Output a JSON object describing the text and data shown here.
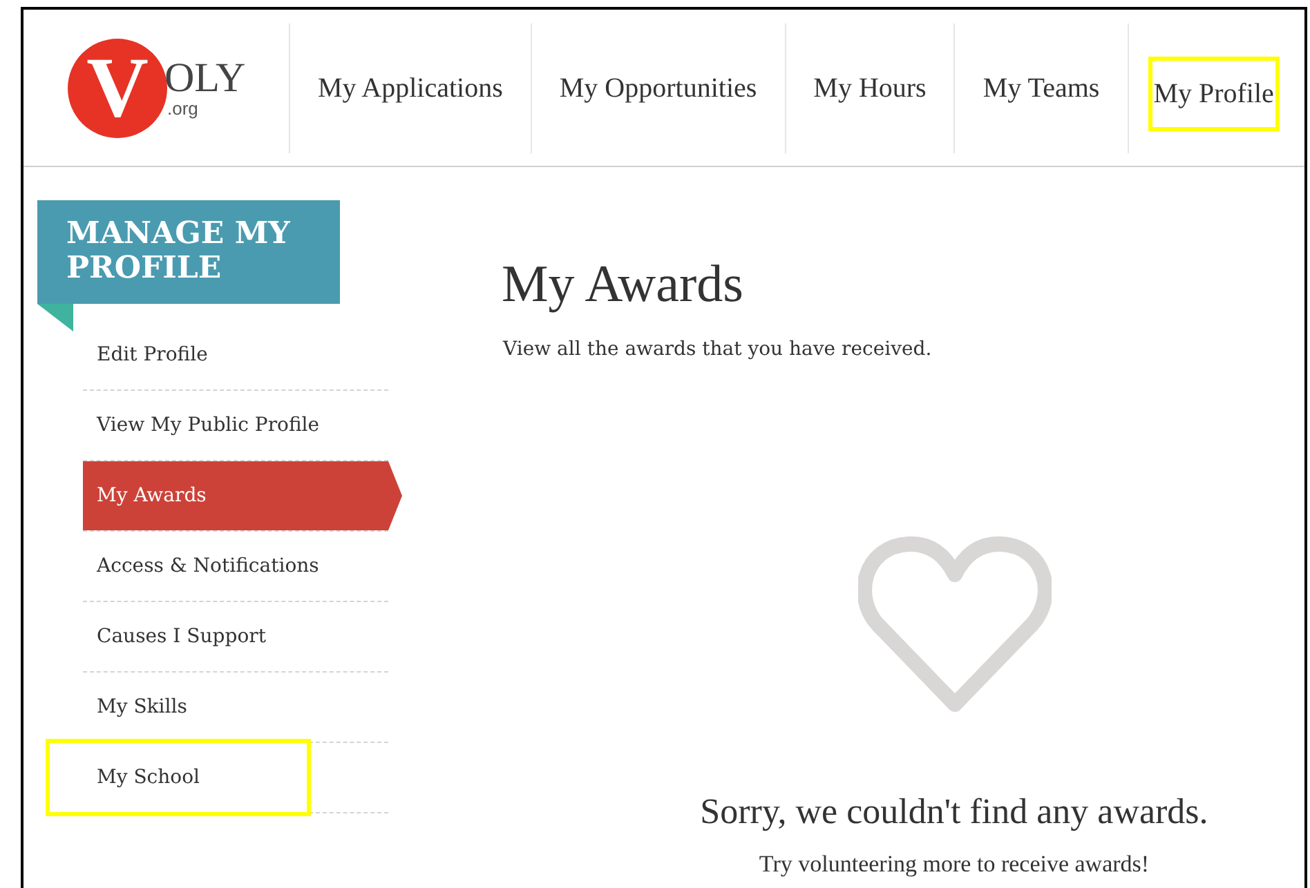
{
  "logo": {
    "letter": "V",
    "wordmark": "OLY",
    "domain": ".org"
  },
  "nav": [
    {
      "label": "My Applications",
      "highlighted": false
    },
    {
      "label": "My Opportunities",
      "highlighted": false
    },
    {
      "label": "My Hours",
      "highlighted": false
    },
    {
      "label": "My Teams",
      "highlighted": false
    },
    {
      "label": "My Profile",
      "highlighted": true
    }
  ],
  "sidebar": {
    "title": "MANAGE MY PROFILE",
    "items": [
      {
        "label": "Edit Profile",
        "selected": false,
        "highlighted": false
      },
      {
        "label": "View My Public Profile",
        "selected": false,
        "highlighted": false
      },
      {
        "label": "My Awards",
        "selected": true,
        "highlighted": false
      },
      {
        "label": "Access & Notifications",
        "selected": false,
        "highlighted": false
      },
      {
        "label": "Causes I Support",
        "selected": false,
        "highlighted": false
      },
      {
        "label": "My Skills",
        "selected": false,
        "highlighted": false
      },
      {
        "label": "My School",
        "selected": false,
        "highlighted": true
      }
    ]
  },
  "main": {
    "title": "My Awards",
    "subtitle": "View all the awards that you have received.",
    "empty_title": "Sorry, we couldn't find any awards.",
    "empty_hint": "Try volunteering more to receive awards!"
  }
}
